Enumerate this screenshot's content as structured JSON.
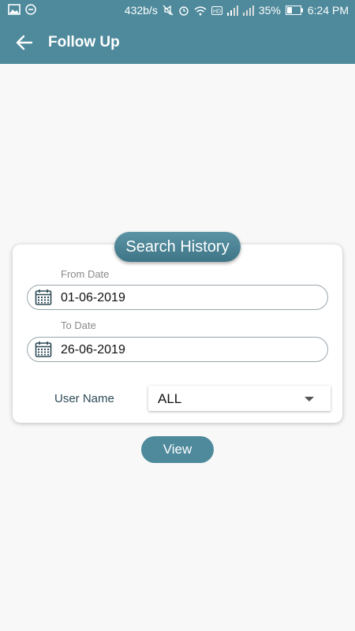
{
  "status_bar": {
    "speed": "432b/s",
    "battery": "35%",
    "time": "6:24 PM",
    "icons": [
      "image-icon",
      "minus-circle-icon",
      "mute-icon",
      "alarm-icon",
      "wifi-icon",
      "hd-icon",
      "signal-icon",
      "signal-icon",
      "battery-icon"
    ]
  },
  "app_bar": {
    "title": "Follow Up",
    "back_icon": "arrow-left-icon"
  },
  "search_card": {
    "title": "Search History",
    "from_date": {
      "label": "From Date",
      "value": "01-06-2019",
      "icon": "calendar-icon"
    },
    "to_date": {
      "label": "To Date",
      "value": "26-06-2019",
      "icon": "calendar-icon"
    },
    "user_name": {
      "label": "User Name",
      "selected": "ALL"
    }
  },
  "view_button": {
    "label": "View"
  },
  "colors": {
    "primary": "#4e8a9c",
    "background": "#f8f8f8"
  }
}
